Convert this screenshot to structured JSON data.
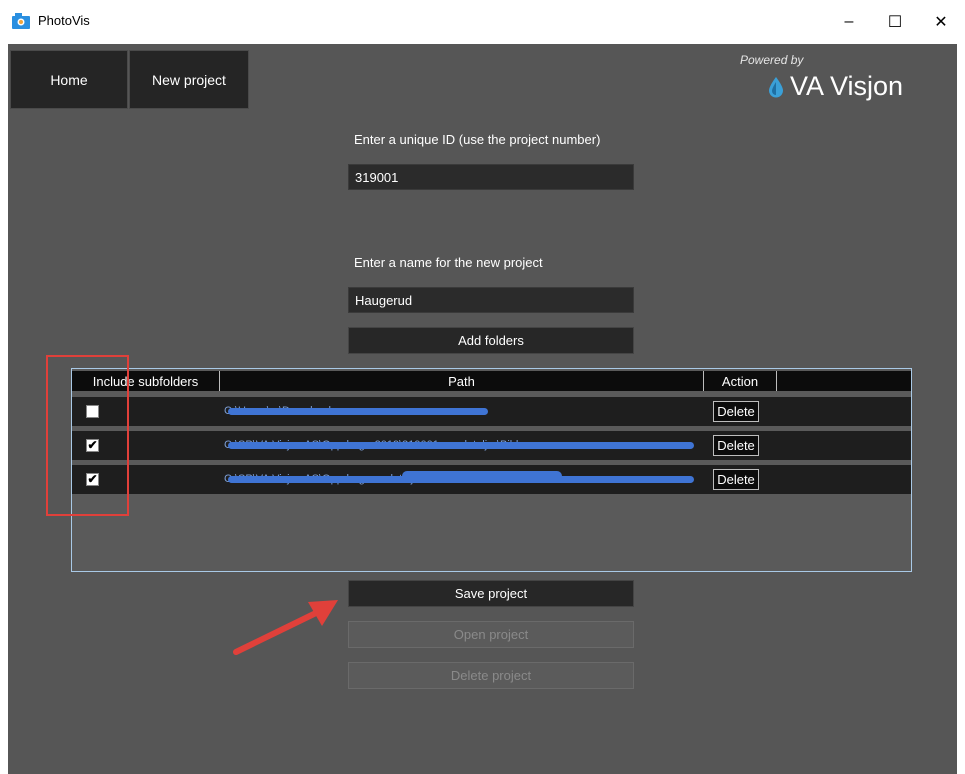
{
  "window": {
    "title": "PhotoVis",
    "min_symbol": "–",
    "max_symbol": "☐",
    "close_symbol": "✕"
  },
  "nav": {
    "home": "Home",
    "new_project": "New project"
  },
  "brand": {
    "powered_by": "Powered by",
    "name": "VA Visjon"
  },
  "form": {
    "id_label": "Enter a unique ID (use the project number)",
    "id_value": "319001",
    "name_label": "Enter a name for the new project",
    "name_value": "Haugerud",
    "add_folders": "Add folders"
  },
  "grid": {
    "columns": [
      "Include subfolders",
      "Path",
      "Action"
    ],
    "rows": [
      {
        "checked": false,
        "path": "C:\\Users\\...\\Downloads",
        "action": "Delete"
      },
      {
        "checked": true,
        "path": "C:\\SP\\VA Visjon AS\\Oppdrag - 2019\\319001 - ... detaljer\\Bilder",
        "action": "Delete"
      },
      {
        "checked": true,
        "path": "C:\\SP\\VA Visjon AS\\Oppdrag - ... detaljer\\2.8",
        "action": "Delete"
      }
    ],
    "check_mark": "✔"
  },
  "actions": {
    "save": "Save project",
    "open": "Open project",
    "delete": "Delete project"
  },
  "colors": {
    "app_bg": "#565656",
    "annotation": "#e0403a",
    "redaction": "#3f74d4"
  }
}
